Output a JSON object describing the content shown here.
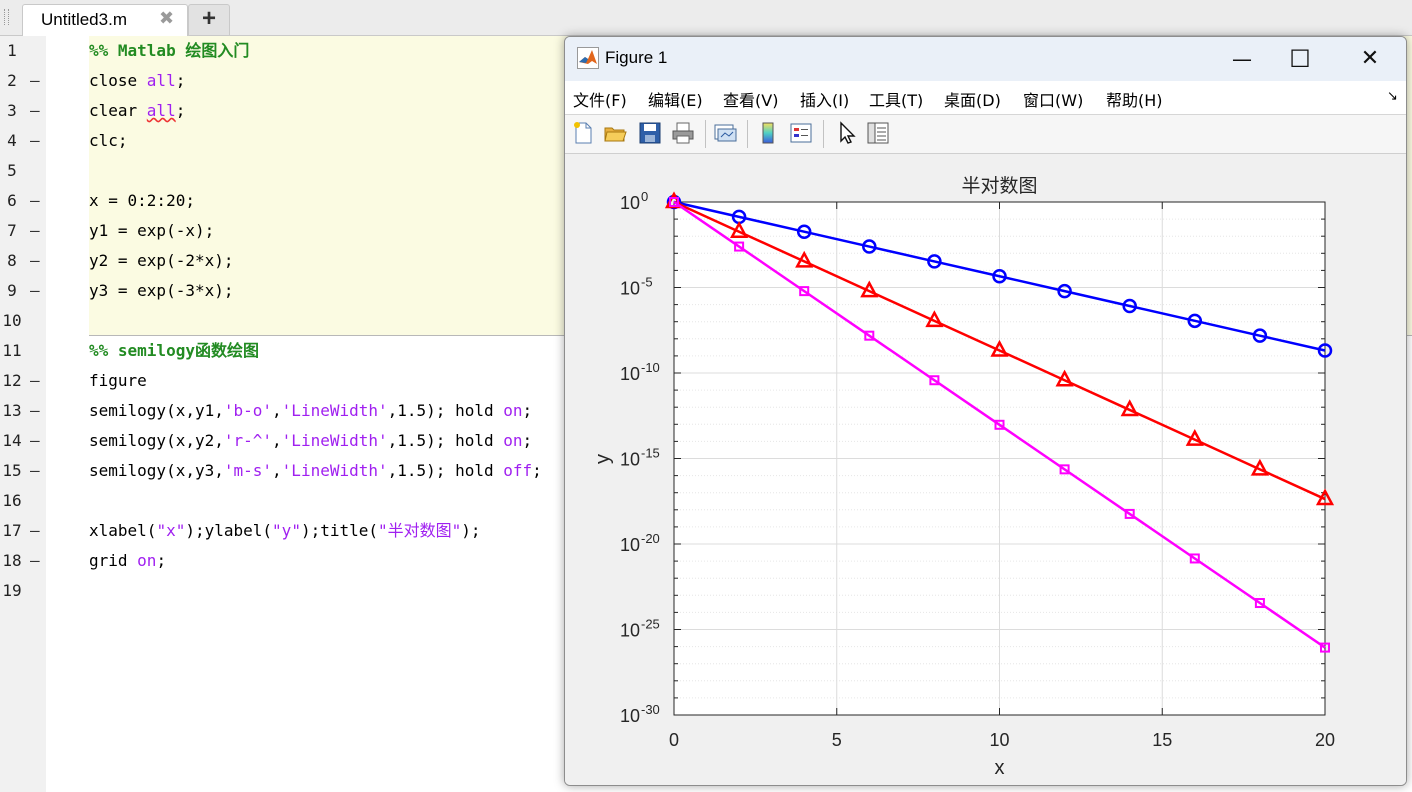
{
  "editor": {
    "tab_name": "Untitled3.m",
    "tab_close": "✖",
    "new_tab": "+",
    "lines": [
      {
        "n": "1",
        "dash": "",
        "tokens": [
          {
            "t": "%% Matlab 绘图入门",
            "c": "cm"
          }
        ]
      },
      {
        "n": "2",
        "dash": "—",
        "tokens": [
          {
            "t": "close ",
            "c": ""
          },
          {
            "t": "all",
            "c": "kw"
          },
          {
            "t": ";",
            "c": ""
          }
        ]
      },
      {
        "n": "3",
        "dash": "—",
        "tokens": [
          {
            "t": "clear ",
            "c": ""
          },
          {
            "t": "all",
            "c": "kw sq"
          },
          {
            "t": ";",
            "c": ""
          }
        ]
      },
      {
        "n": "4",
        "dash": "—",
        "tokens": [
          {
            "t": "clc;",
            "c": ""
          }
        ]
      },
      {
        "n": "5",
        "dash": "",
        "tokens": []
      },
      {
        "n": "6",
        "dash": "—",
        "tokens": [
          {
            "t": "x = 0:2:20;",
            "c": ""
          }
        ]
      },
      {
        "n": "7",
        "dash": "—",
        "tokens": [
          {
            "t": "y1 = exp(-x);",
            "c": ""
          }
        ]
      },
      {
        "n": "8",
        "dash": "—",
        "tokens": [
          {
            "t": "y2 = exp(-2*x);",
            "c": ""
          }
        ]
      },
      {
        "n": "9",
        "dash": "—",
        "tokens": [
          {
            "t": "y3 = exp(-3*x);",
            "c": ""
          }
        ]
      },
      {
        "n": "10",
        "dash": "",
        "tokens": []
      },
      {
        "n": "11",
        "dash": "",
        "tokens": [
          {
            "t": "%% semilogy函数绘图",
            "c": "cm"
          }
        ]
      },
      {
        "n": "12",
        "dash": "—",
        "tokens": [
          {
            "t": "figure",
            "c": ""
          }
        ]
      },
      {
        "n": "13",
        "dash": "—",
        "tokens": [
          {
            "t": "semilogy(x,y1,",
            "c": ""
          },
          {
            "t": "'b-o'",
            "c": "str"
          },
          {
            "t": ",",
            "c": ""
          },
          {
            "t": "'LineWidth'",
            "c": "str"
          },
          {
            "t": ",1.5); hold ",
            "c": ""
          },
          {
            "t": "on",
            "c": "kw"
          },
          {
            "t": ";",
            "c": ""
          }
        ]
      },
      {
        "n": "14",
        "dash": "—",
        "tokens": [
          {
            "t": "semilogy(x,y2,",
            "c": ""
          },
          {
            "t": "'r-^'",
            "c": "str"
          },
          {
            "t": ",",
            "c": ""
          },
          {
            "t": "'LineWidth'",
            "c": "str"
          },
          {
            "t": ",1.5); hold ",
            "c": ""
          },
          {
            "t": "on",
            "c": "kw"
          },
          {
            "t": ";",
            "c": ""
          }
        ]
      },
      {
        "n": "15",
        "dash": "—",
        "tokens": [
          {
            "t": "semilogy(x,y3,",
            "c": ""
          },
          {
            "t": "'m-s'",
            "c": "str"
          },
          {
            "t": ",",
            "c": ""
          },
          {
            "t": "'LineWidth'",
            "c": "str"
          },
          {
            "t": ",1.5); hold ",
            "c": ""
          },
          {
            "t": "off",
            "c": "kw"
          },
          {
            "t": ";",
            "c": ""
          }
        ]
      },
      {
        "n": "16",
        "dash": "",
        "tokens": []
      },
      {
        "n": "17",
        "dash": "—",
        "tokens": [
          {
            "t": "xlabel(",
            "c": ""
          },
          {
            "t": "\"x\"",
            "c": "str"
          },
          {
            "t": ");ylabel(",
            "c": ""
          },
          {
            "t": "\"y\"",
            "c": "str"
          },
          {
            "t": ");title(",
            "c": ""
          },
          {
            "t": "\"半对数图\"",
            "c": "str"
          },
          {
            "t": ");",
            "c": ""
          }
        ]
      },
      {
        "n": "18",
        "dash": "—",
        "tokens": [
          {
            "t": "grid ",
            "c": ""
          },
          {
            "t": "on",
            "c": "kw"
          },
          {
            "t": ";",
            "c": ""
          }
        ]
      },
      {
        "n": "19",
        "dash": "",
        "tokens": []
      }
    ]
  },
  "figure": {
    "title": "Figure 1",
    "minimize": "—",
    "maximize": "☐",
    "close": "✕",
    "menus": [
      "文件(F)",
      "编辑(E)",
      "查看(V)",
      "插入(I)",
      "工具(T)",
      "桌面(D)",
      "窗口(W)",
      "帮助(H)"
    ],
    "menu_arrow": "↘",
    "toolbar_icons": [
      "new-file-icon",
      "open-folder-icon",
      "save-icon",
      "print-icon",
      "link-plot-icon",
      "colorbar-icon",
      "legend-icon",
      "pointer-icon",
      "property-inspector-icon"
    ]
  },
  "colors": {
    "series1": "#0000ff",
    "series2": "#ff0000",
    "series3": "#ff00ff",
    "comment": "#228b22",
    "keyword": "#a020f0"
  },
  "chart_data": {
    "type": "line",
    "title": "半对数图",
    "xlabel": "x",
    "ylabel": "y",
    "yscale": "log",
    "grid": true,
    "xlim": [
      0,
      20
    ],
    "ylim_exponent": [
      -30,
      0
    ],
    "xticks": [
      "0",
      "5",
      "10",
      "15",
      "20"
    ],
    "yticks": [
      {
        "base": "10",
        "exp": "0"
      },
      {
        "base": "10",
        "exp": "-5"
      },
      {
        "base": "10",
        "exp": "-10"
      },
      {
        "base": "10",
        "exp": "-15"
      },
      {
        "base": "10",
        "exp": "-20"
      },
      {
        "base": "10",
        "exp": "-25"
      },
      {
        "base": "10",
        "exp": "-30"
      }
    ],
    "x": [
      0,
      2,
      4,
      6,
      8,
      10,
      12,
      14,
      16,
      18,
      20
    ],
    "series": [
      {
        "marker": "circle",
        "color": "#0000ff",
        "values": [
          1,
          0.1353,
          0.01832,
          0.002479,
          0.0003355,
          4.54e-05,
          6.144e-06,
          8.315e-07,
          1.125e-07,
          1.523e-08,
          2.061e-09
        ]
      },
      {
        "marker": "triangle",
        "color": "#ff0000",
        "values": [
          1,
          0.01832,
          0.0003355,
          6.144e-06,
          1.125e-07,
          2.061e-09,
          3.775e-11,
          6.914e-13,
          1.266e-14,
          2.32e-16,
          4.248e-18
        ]
      },
      {
        "marker": "square",
        "color": "#ff00ff",
        "values": [
          1,
          0.002479,
          6.144e-06,
          1.523e-08,
          3.775e-11,
          9.358e-14,
          2.32e-16,
          5.75e-19,
          1.425e-21,
          3.532e-24,
          8.757e-27
        ]
      }
    ]
  }
}
